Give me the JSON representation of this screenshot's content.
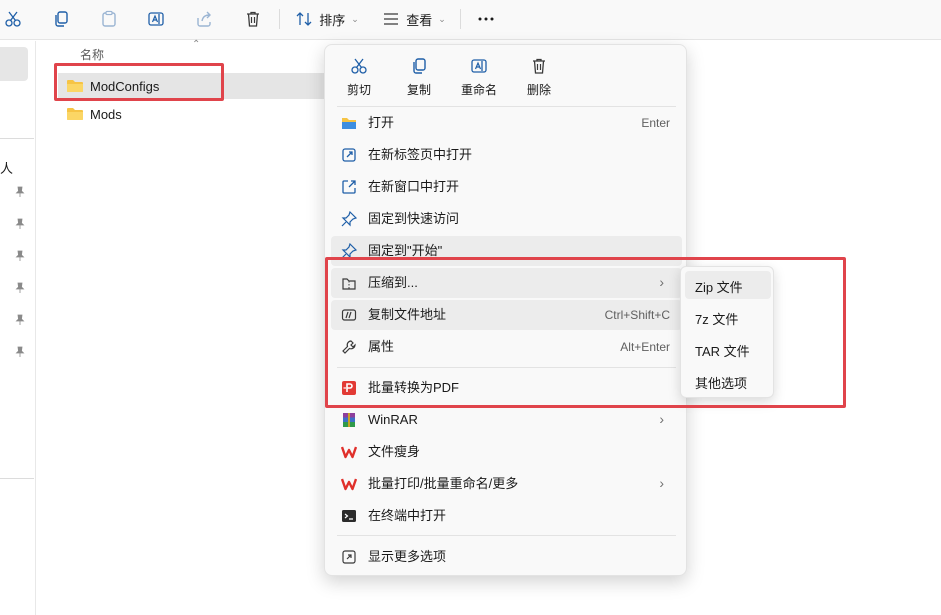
{
  "toolbar": {
    "sort_label": "排序",
    "view_label": "查看"
  },
  "sidebar": {
    "partial_text": "人"
  },
  "filelist": {
    "column_name": "名称",
    "items": [
      {
        "name": "ModConfigs",
        "selected": true
      },
      {
        "name": "Mods",
        "selected": false
      }
    ]
  },
  "context_menu": {
    "quick_actions": [
      {
        "label": "剪切",
        "icon": "cut-icon"
      },
      {
        "label": "复制",
        "icon": "copy-icon"
      },
      {
        "label": "重命名",
        "icon": "rename-icon"
      },
      {
        "label": "删除",
        "icon": "delete-icon"
      }
    ],
    "items": [
      {
        "label": "打开",
        "shortcut": "Enter",
        "icon": "folder-open-icon"
      },
      {
        "label": "在新标签页中打开",
        "shortcut": "",
        "icon": "new-tab-icon"
      },
      {
        "label": "在新窗口中打开",
        "shortcut": "",
        "icon": "new-window-icon"
      },
      {
        "label": "固定到快速访问",
        "shortcut": "",
        "icon": "pin-icon"
      },
      {
        "label": "固定到\"开始\"",
        "shortcut": "",
        "icon": "pin-start-icon"
      },
      {
        "label": "压缩到...",
        "shortcut": "",
        "icon": "archive-icon",
        "submenu": true
      },
      {
        "label": "复制文件地址",
        "shortcut": "Ctrl+Shift+C",
        "icon": "copy-path-icon"
      },
      {
        "label": "属性",
        "shortcut": "Alt+Enter",
        "icon": "wrench-icon"
      },
      {
        "label": "批量转换为PDF",
        "shortcut": "",
        "icon": "pdf-convert-icon"
      },
      {
        "label": "WinRAR",
        "shortcut": "",
        "icon": "winrar-icon",
        "submenu": true
      },
      {
        "label": "文件瘦身",
        "shortcut": "",
        "icon": "wps-icon"
      },
      {
        "label": "批量打印/批量重命名/更多",
        "shortcut": "",
        "icon": "wps-icon",
        "submenu": true
      },
      {
        "label": "在终端中打开",
        "shortcut": "",
        "icon": "terminal-icon"
      },
      {
        "label": "显示更多选项",
        "shortcut": "",
        "icon": "more-options-icon"
      }
    ]
  },
  "submenu": {
    "items": [
      "Zip 文件",
      "7z 文件",
      "TAR 文件",
      "其他选项"
    ]
  },
  "colors": {
    "highlight_border": "#e0444b",
    "folder": "#f6c445",
    "wps_red": "#e0302b",
    "pdf_red": "#e23a35"
  }
}
